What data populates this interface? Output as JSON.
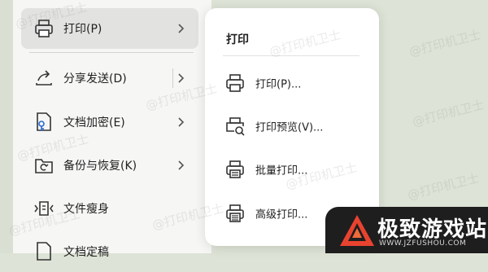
{
  "main_menu": {
    "items": [
      {
        "label": "打印(P)",
        "icon": "printer-icon",
        "has_submenu": true,
        "selected": true
      },
      {
        "label": "分享发送(D)",
        "icon": "share-icon",
        "has_submenu": true,
        "selected": false
      },
      {
        "label": "文档加密(E)",
        "icon": "lock-document-icon",
        "has_submenu": true,
        "selected": false
      },
      {
        "label": "备份与恢复(K)",
        "icon": "backup-folder-icon",
        "has_submenu": true,
        "selected": false
      },
      {
        "label": "文件瘦身",
        "icon": "slim-file-icon",
        "has_submenu": false,
        "selected": false
      },
      {
        "label": "文档定稿",
        "icon": "finalize-document-icon",
        "has_submenu": false,
        "selected": false
      }
    ]
  },
  "submenu": {
    "title": "打印",
    "items": [
      {
        "label": "打印(P)...",
        "icon": "printer-icon"
      },
      {
        "label": "打印预览(V)...",
        "icon": "print-preview-icon"
      },
      {
        "label": "批量打印...",
        "icon": "batch-print-icon"
      },
      {
        "label": "高级打印...",
        "icon": "advanced-print-icon"
      }
    ]
  },
  "watermark": {
    "text": "@打印机卫士"
  },
  "logo": {
    "title": "极致游戏站",
    "url": "WWW.JZFUSHOU.COM"
  },
  "colors": {
    "selected_bg": "#e2e2e0",
    "logo_bg": "#1e1e1e",
    "logo_accent": "#e8432f",
    "page_bg": "#dde3d6"
  }
}
